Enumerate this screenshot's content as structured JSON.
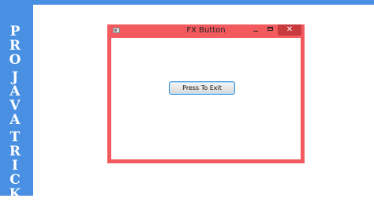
{
  "banner": {
    "letters": [
      "P",
      "R",
      "O",
      "J",
      "A",
      "V",
      "A",
      "T",
      "R",
      "I",
      "C",
      "K"
    ]
  },
  "window": {
    "title": "FX Button",
    "icons": {
      "app": "app-icon",
      "minimize": "minimize-icon",
      "maximize": "maximize-icon",
      "close": "close-icon"
    },
    "close_glyph": "✕",
    "colors": {
      "frame": "#f35a5e",
      "close": "#c73b3e"
    }
  },
  "content": {
    "button_label": "Press To Exit"
  },
  "colors": {
    "banner": "#4a90e2"
  }
}
